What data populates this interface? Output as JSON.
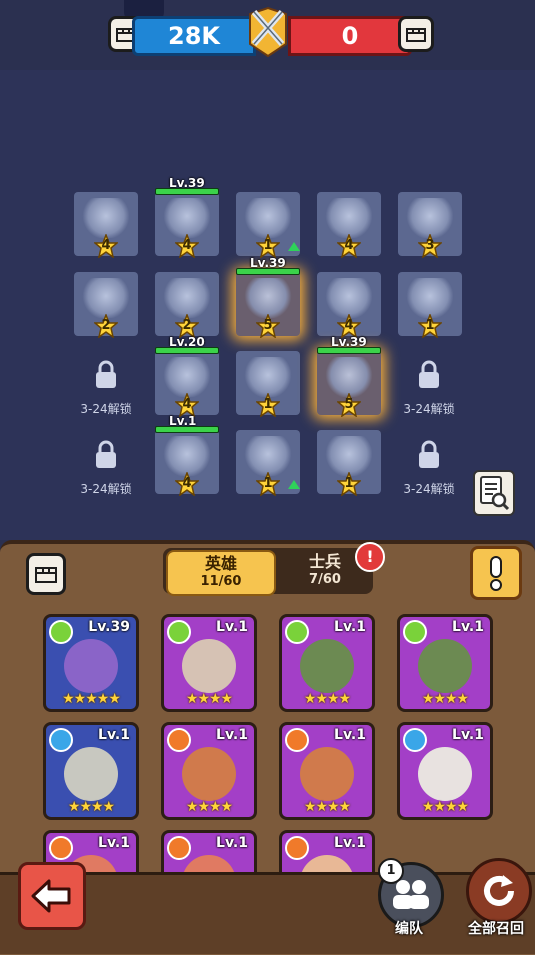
{
  "scoreboard": {
    "player_score": "28K",
    "enemy_score": "0",
    "player_color": "#1f86d6",
    "enemy_color": "#e2373d"
  },
  "board": {
    "tiles": [
      {
        "stars": "4",
        "level": "",
        "hp": false,
        "glow": false,
        "upgrade": false,
        "unit": "soldier-squad-blue"
      },
      {
        "stars": "4",
        "level": "Lv.39",
        "hp": true,
        "glow": false,
        "upgrade": false,
        "unit": "beast-hero"
      },
      {
        "stars": "1",
        "level": "",
        "hp": false,
        "glow": false,
        "upgrade": true,
        "unit": "fire-beast"
      },
      {
        "stars": "4",
        "level": "",
        "hp": false,
        "glow": false,
        "upgrade": false,
        "unit": "bone-creature"
      },
      {
        "stars": "3",
        "level": "",
        "hp": false,
        "glow": false,
        "upgrade": false,
        "unit": "spear-squad"
      },
      {
        "stars": "2",
        "level": "",
        "hp": false,
        "glow": false,
        "upgrade": false,
        "unit": "soldier-squad-blue"
      },
      {
        "stars": "2",
        "level": "",
        "hp": false,
        "glow": false,
        "upgrade": false,
        "unit": "dragon-hero"
      },
      {
        "stars": "5",
        "level": "Lv.39",
        "hp": true,
        "glow": true,
        "upgrade": false,
        "unit": "spirit-hero"
      },
      {
        "stars": "4",
        "level": "",
        "hp": false,
        "glow": false,
        "upgrade": false,
        "unit": "goblin-squad"
      },
      {
        "stars": "1",
        "level": "",
        "hp": false,
        "glow": false,
        "upgrade": false,
        "unit": "soldier-squad-blue"
      },
      {
        "stars": "4",
        "level": "Lv.20",
        "hp": true,
        "glow": false,
        "upgrade": false,
        "unit": "fire-hero"
      },
      {
        "stars": "1",
        "level": "",
        "hp": false,
        "glow": false,
        "upgrade": false,
        "unit": "spear-squad"
      },
      {
        "stars": "5",
        "level": "Lv.39",
        "hp": true,
        "glow": true,
        "upgrade": false,
        "unit": "warrior-hero"
      },
      {
        "stars": "4",
        "level": "Lv.1",
        "hp": true,
        "glow": false,
        "upgrade": false,
        "unit": "green-hero"
      },
      {
        "stars": "1",
        "level": "",
        "hp": false,
        "glow": false,
        "upgrade": true,
        "unit": "fire-beast"
      },
      {
        "stars": "1",
        "level": "",
        "hp": false,
        "glow": false,
        "upgrade": false,
        "unit": "siege-machine"
      }
    ],
    "locked_slot_label": "3-24解锁"
  },
  "tabs": {
    "heroes_label": "英雄",
    "heroes_count": "11/60",
    "soldiers_label": "士兵",
    "soldiers_count": "7/60",
    "alert_mark": "!",
    "info_mark": "!"
  },
  "hero_cards": [
    {
      "level": "Lv.39",
      "stars": "★★★★★",
      "element": "leaf",
      "element_color": "#7ad23a",
      "bg": "#3a4fb0",
      "face": "#8a64c8"
    },
    {
      "level": "Lv.1",
      "stars": "★★★★",
      "element": "leaf",
      "element_color": "#7ad23a",
      "bg": "#a33fc7",
      "face": "#d6c2b4"
    },
    {
      "level": "Lv.1",
      "stars": "★★★★",
      "element": "leaf",
      "element_color": "#7ad23a",
      "bg": "#a33fc7",
      "face": "#6c8a52"
    },
    {
      "level": "Lv.1",
      "stars": "★★★★",
      "element": "leaf",
      "element_color": "#7ad23a",
      "bg": "#a33fc7",
      "face": "#6c8a52"
    },
    {
      "level": "Lv.1",
      "stars": "★★★★",
      "element": "water",
      "element_color": "#3aa6e8",
      "bg": "#3a4fb0",
      "face": "#c8c8c0"
    },
    {
      "level": "Lv.1",
      "stars": "★★★★",
      "element": "fire",
      "element_color": "#f07a2a",
      "bg": "#a33fc7",
      "face": "#d07a4c"
    },
    {
      "level": "Lv.1",
      "stars": "★★★★",
      "element": "fire",
      "element_color": "#f07a2a",
      "bg": "#a33fc7",
      "face": "#d07a4c"
    },
    {
      "level": "Lv.1",
      "stars": "★★★★",
      "element": "water",
      "element_color": "#3aa6e8",
      "bg": "#a33fc7",
      "face": "#e8e2e0"
    },
    {
      "level": "Lv.1",
      "stars": "",
      "element": "fire",
      "element_color": "#f07a2a",
      "bg": "#a33fc7",
      "face": "#e07a62"
    },
    {
      "level": "Lv.1",
      "stars": "",
      "element": "fire",
      "element_color": "#f07a2a",
      "bg": "#a33fc7",
      "face": "#e07a62"
    },
    {
      "level": "Lv.1",
      "stars": "",
      "element": "fire",
      "element_color": "#f07a2a",
      "bg": "#a33fc7",
      "face": "#e8b896"
    }
  ],
  "bottom": {
    "formation_label": "编队",
    "formation_badge": "1",
    "recall_label": "全部召回"
  }
}
